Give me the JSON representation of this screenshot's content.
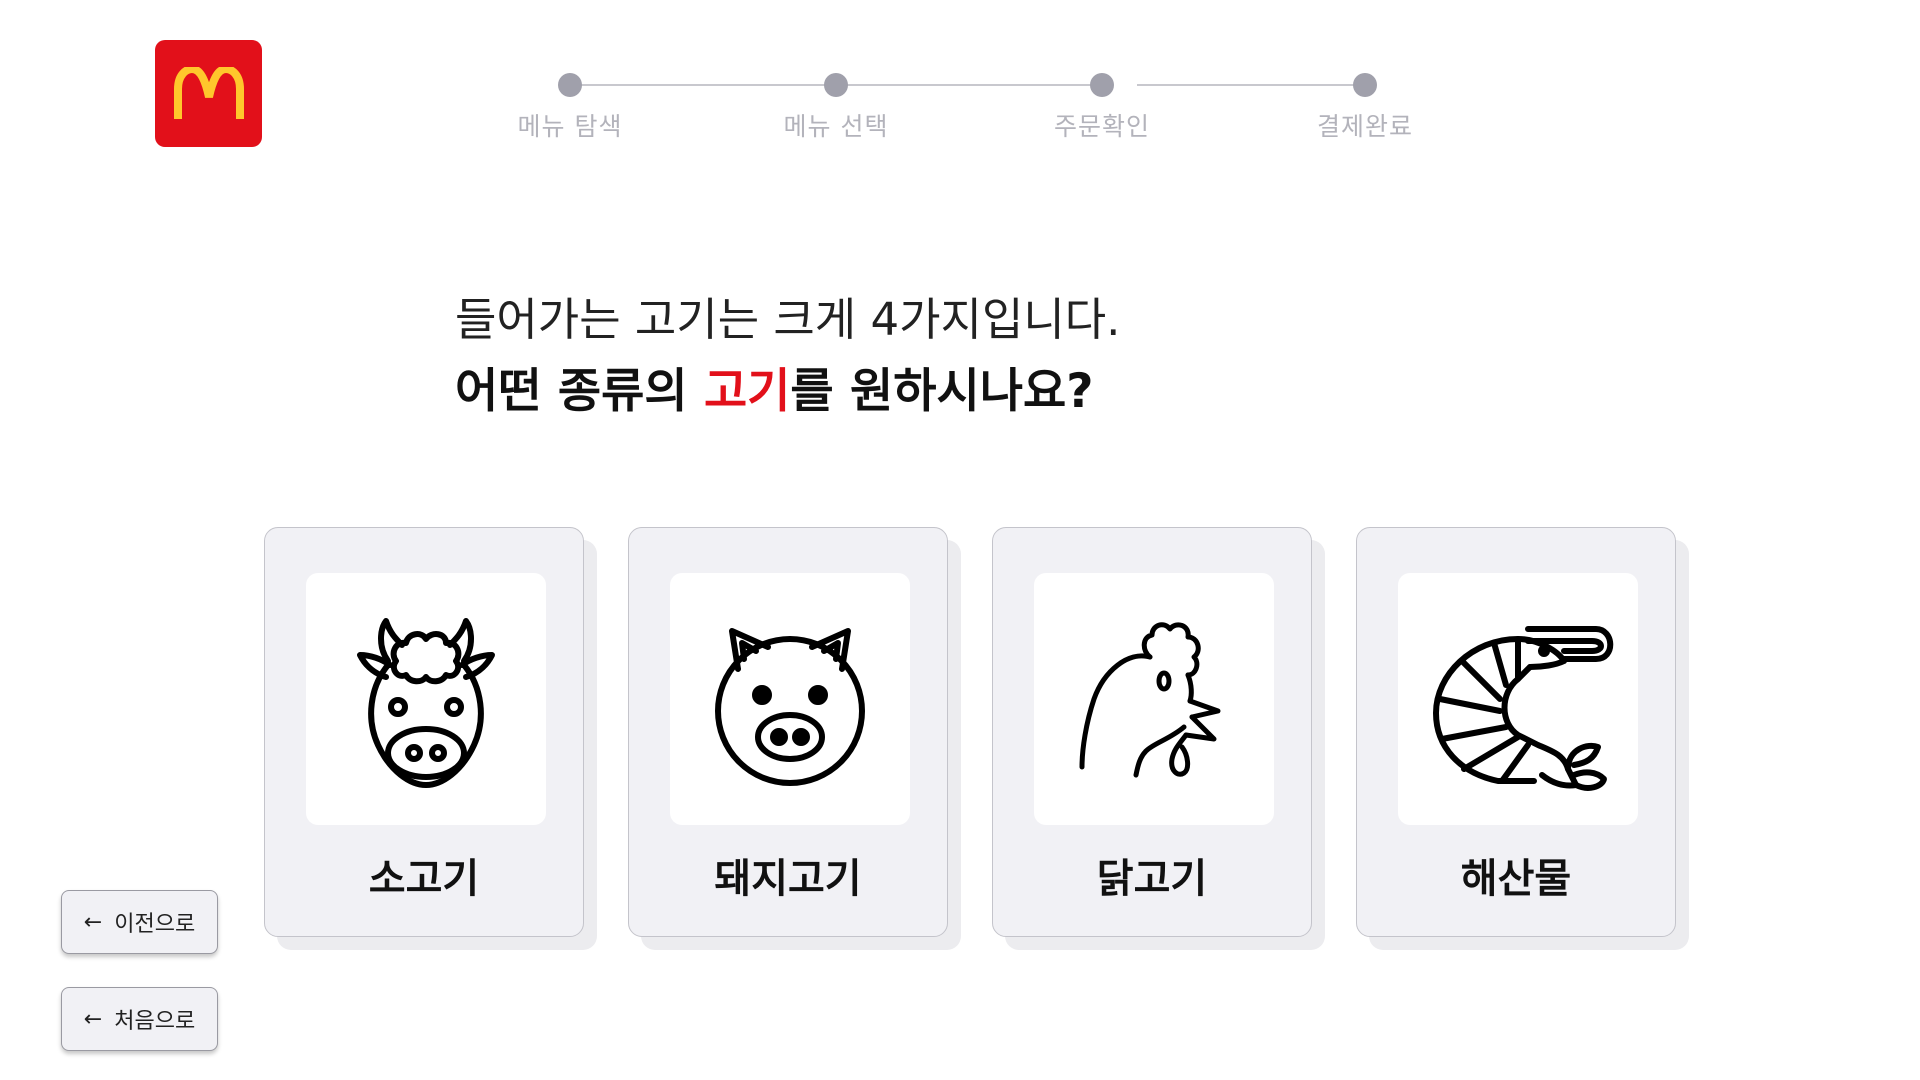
{
  "brand": {
    "logo_letter": "M",
    "logo_bg": "#e2101a",
    "logo_fg": "#ffc72c"
  },
  "stepper": {
    "steps": [
      {
        "label": "메뉴 탐색"
      },
      {
        "label": "메뉴 선택"
      },
      {
        "label": "주문확인"
      },
      {
        "label": "결제완료"
      }
    ]
  },
  "question": {
    "line1": "들어가는 고기는 크게 4가지입니다.",
    "line2_prefix": "어떤 종류의 ",
    "line2_highlight": "고기",
    "line2_suffix": "를 원하시나요?"
  },
  "options": [
    {
      "label": "소고기",
      "icon": "cow-icon"
    },
    {
      "label": "돼지고기",
      "icon": "pig-icon"
    },
    {
      "label": "닭고기",
      "icon": "chicken-icon"
    },
    {
      "label": "해산물",
      "icon": "shrimp-icon"
    }
  ],
  "nav": {
    "back_label": "이전으로",
    "home_label": "처음으로",
    "arrow_icon": "arrow-left-icon"
  },
  "colors": {
    "accent": "#e2101a",
    "card_bg": "#f1f1f5",
    "step_dot": "#a0a0ab"
  }
}
